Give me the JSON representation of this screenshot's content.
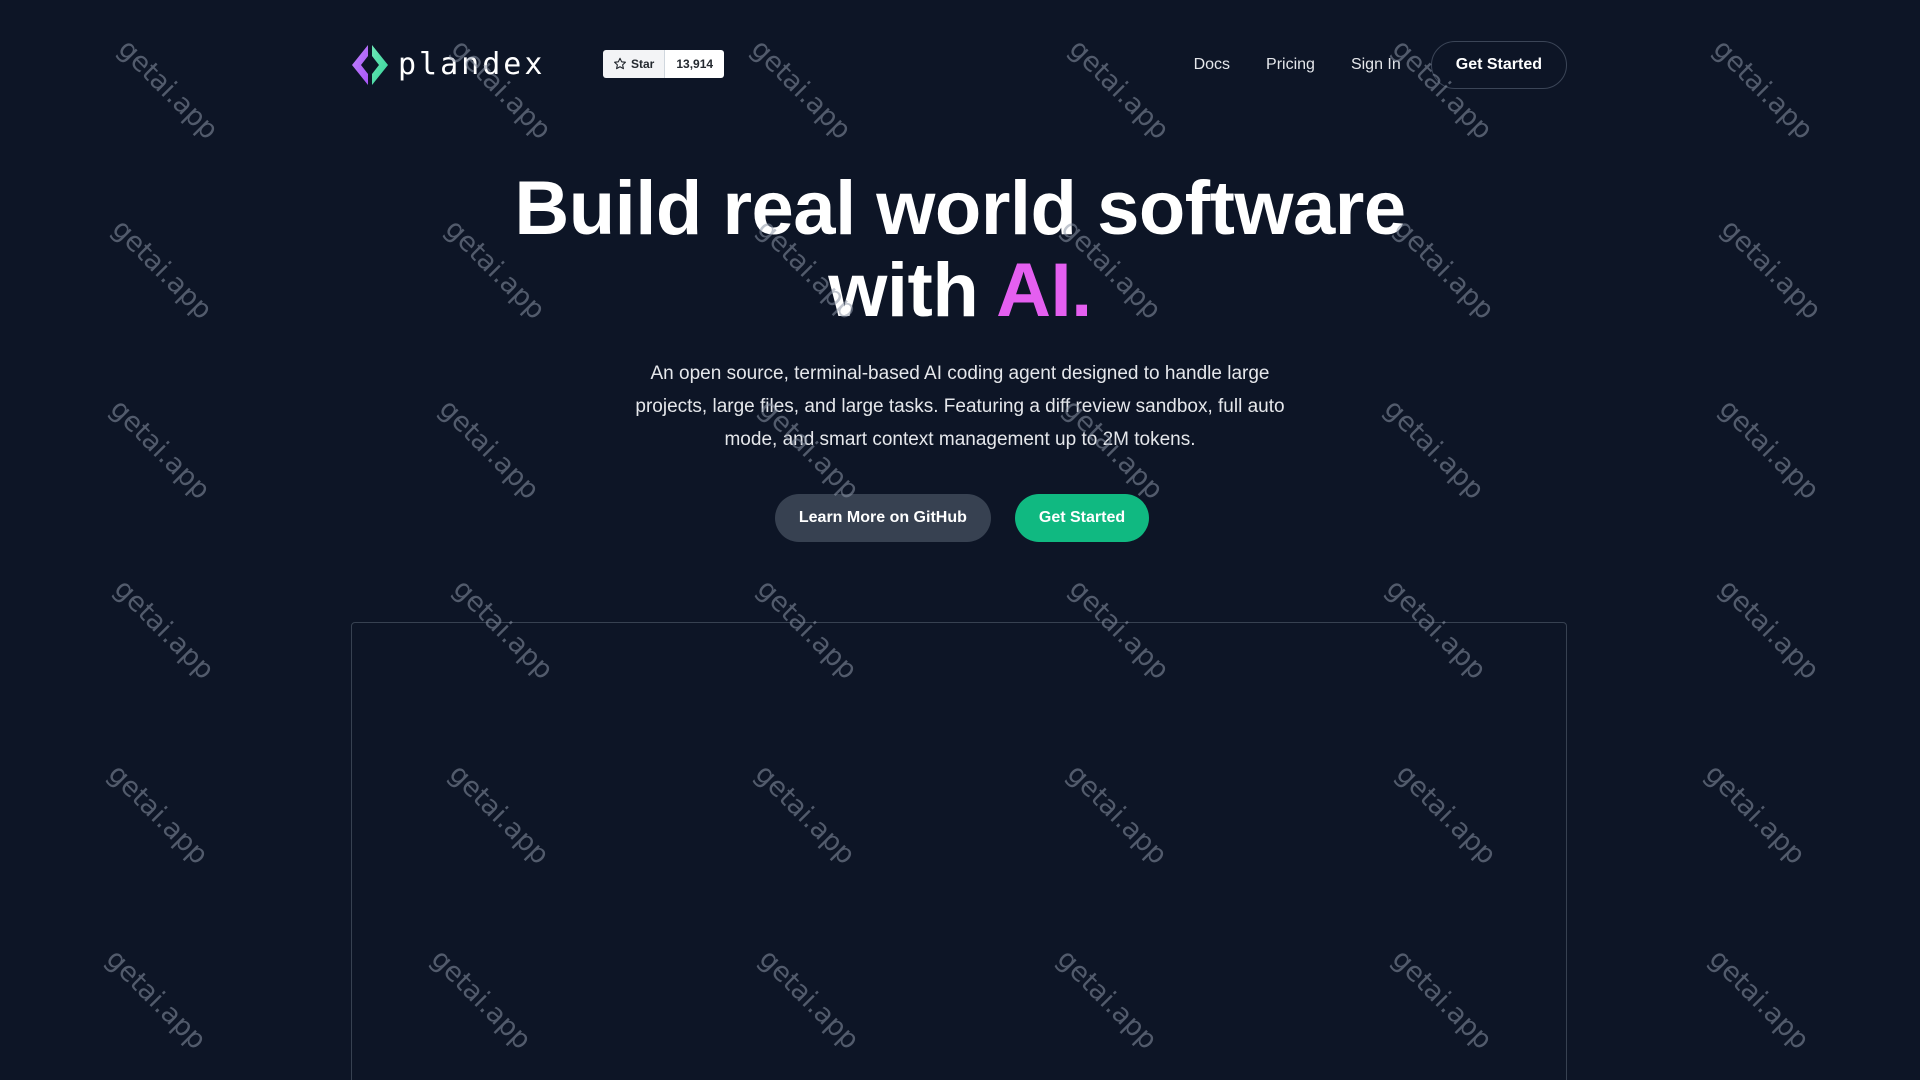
{
  "header": {
    "brand_name": "plandex",
    "github": {
      "star_label": "Star",
      "star_count": "13,914"
    },
    "nav": {
      "docs": "Docs",
      "pricing": "Pricing",
      "sign_in": "Sign In",
      "get_started": "Get Started"
    }
  },
  "hero": {
    "title_line1": "Build real world software",
    "title_line2_prefix": "with ",
    "title_line2_accent": "AI.",
    "subtitle": "An open source, terminal-based AI coding agent designed to handle large projects, large files, and large tasks. Featuring a diff review sandbox, full auto mode, and smart context management up to 2M tokens.",
    "buttons": {
      "secondary": "Learn More on GitHub",
      "primary": "Get Started"
    }
  },
  "watermark_text": "getai.app",
  "colors": {
    "background": "#0d1526",
    "accent": "#e45ff0",
    "primary_button": "#10b981",
    "secondary_button": "#374151"
  }
}
